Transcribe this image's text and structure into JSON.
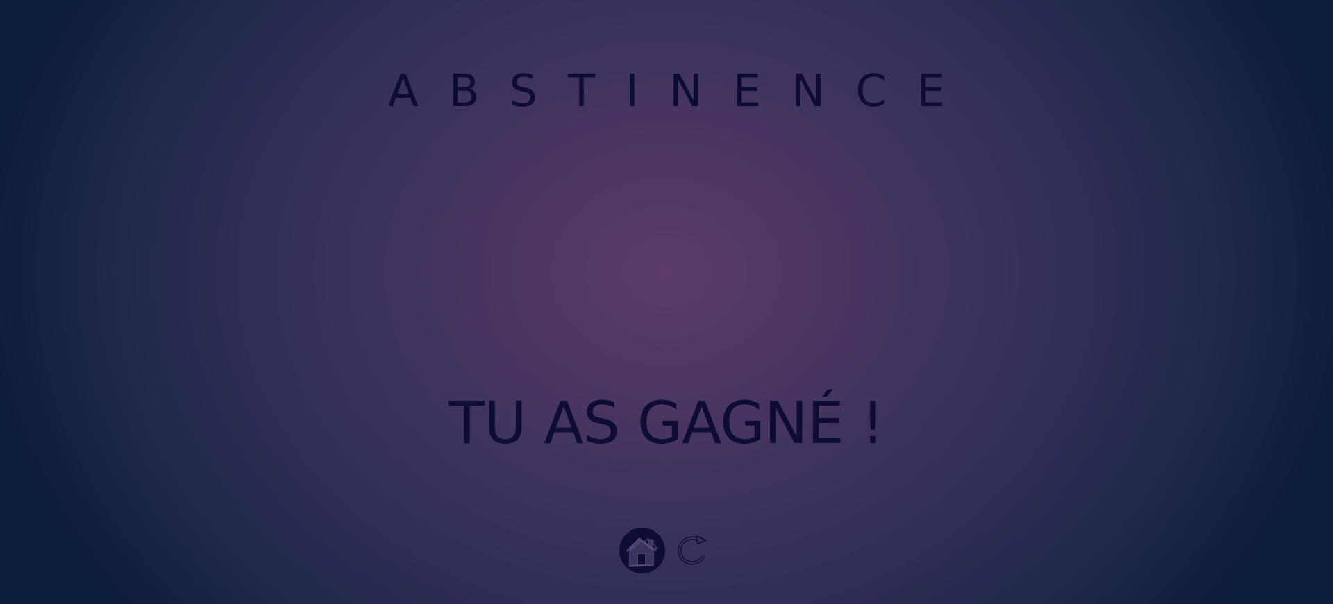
{
  "game": {
    "title": "ABSTINENCE",
    "result_message": "TU AS GAGNÉ !"
  },
  "controls": {
    "home_icon": "home-icon",
    "replay_icon": "replay-icon"
  },
  "colors": {
    "text": "#0c0c35",
    "background_center": "#5c3a6b",
    "background_edge": "#0d1e3a"
  }
}
